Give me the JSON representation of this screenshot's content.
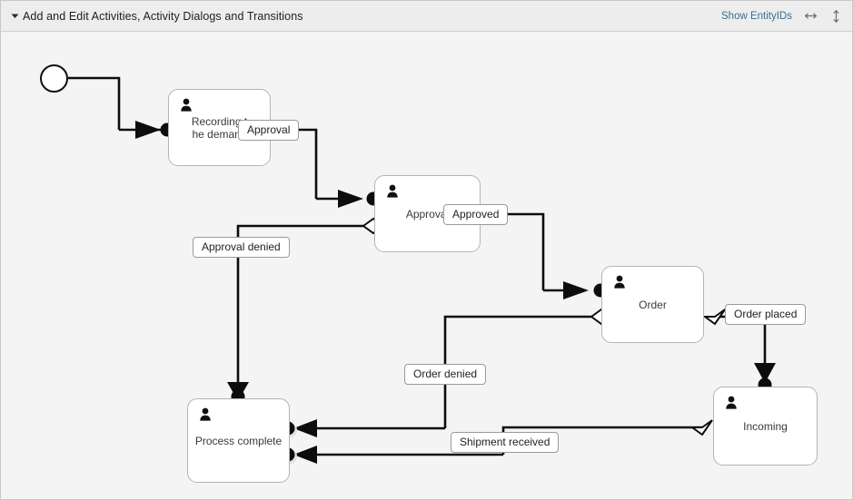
{
  "header": {
    "title": "Add and Edit Activities, Activity Dialogs and Transitions",
    "disclosure_icon": "triangle-down-icon",
    "show_entity_ids_label": "Show EntityIDs",
    "resize_horizontal_icon": "arrows-left-right-icon",
    "resize_vertical_icon": "arrows-up-down-icon"
  },
  "diagram": {
    "start_node": {
      "name": "start-event"
    },
    "nodes": [
      {
        "id": "recording",
        "label": "Recording t\nhe demand",
        "actor_icon": "person-icon"
      },
      {
        "id": "approval",
        "label": "Approval",
        "actor_icon": "person-icon"
      },
      {
        "id": "order",
        "label": "Order",
        "actor_icon": "person-icon"
      },
      {
        "id": "process-complete",
        "label": "Process complete",
        "actor_icon": "person-icon"
      },
      {
        "id": "incoming",
        "label": "Incoming",
        "actor_icon": "person-icon"
      }
    ],
    "transitions": [
      {
        "id": "approval-chip",
        "label": "Approval"
      },
      {
        "id": "approved-chip",
        "label": "Approved"
      },
      {
        "id": "approval-denied-chip",
        "label": "Approval denied"
      },
      {
        "id": "order-placed-chip",
        "label": "Order placed"
      },
      {
        "id": "order-denied-chip",
        "label": "Order denied"
      },
      {
        "id": "shipment-received-chip",
        "label": "Shipment received"
      }
    ]
  }
}
